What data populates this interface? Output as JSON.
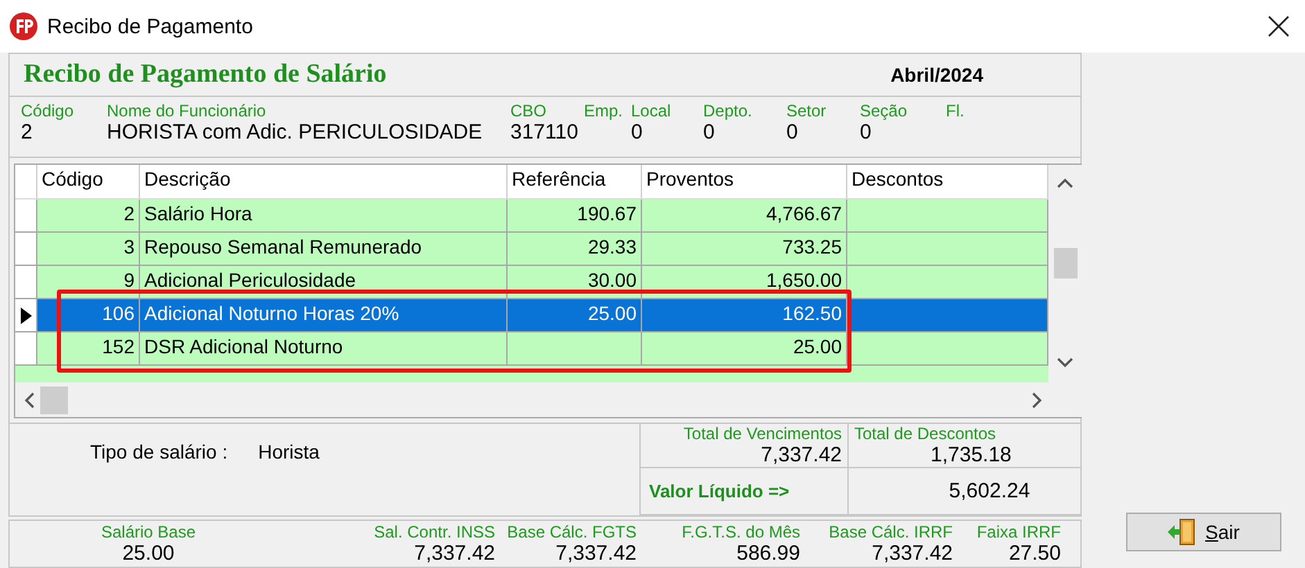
{
  "window": {
    "title": "Recibo de Pagamento"
  },
  "header": {
    "title": "Recibo de Pagamento de Salário",
    "period": "Abril/2024"
  },
  "employee_fields": [
    {
      "label": "Código",
      "value": "2"
    },
    {
      "label": "Nome do Funcionário",
      "value": "HORISTA com Adic. PERICULOSIDADE"
    },
    {
      "label": "CBO",
      "value": "317110"
    },
    {
      "label": "Emp."
    },
    {
      "label": "Local",
      "value": "0"
    },
    {
      "label": "Depto.",
      "value": "0"
    },
    {
      "label": "Setor",
      "value": "0"
    },
    {
      "label": "Seção",
      "value": "0"
    },
    {
      "label": "Fl."
    }
  ],
  "table": {
    "columns": [
      "Código",
      "Descrição",
      "Referência",
      "Proventos",
      "Descontos"
    ],
    "rows": [
      {
        "cells": [
          "2",
          "Salário Hora",
          "190.67",
          "4,766.67"
        ],
        "selected": false
      },
      {
        "cells": [
          "3",
          "Repouso Semanal Remunerado",
          "29.33",
          "733.25"
        ],
        "selected": false
      },
      {
        "cells": [
          "9",
          "Adicional Periculosidade",
          "30.00",
          "1,650.00"
        ],
        "selected": false
      },
      {
        "cells": [
          "106",
          "Adicional Noturno Horas 20%",
          "25.00",
          "162.50"
        ],
        "selected": true
      },
      {
        "cells": [
          "152",
          "DSR Adicional Noturno",
          "",
          "25.00"
        ],
        "selected": false
      }
    ]
  },
  "salary_type": {
    "label": "Tipo de salário :",
    "value": "Horista"
  },
  "totals": [
    {
      "label": "Total de Vencimentos",
      "value": "7,337.42"
    },
    {
      "label": "Total de Descontos",
      "value": "1,735.18"
    }
  ],
  "net": {
    "label": "Valor Líquido  =>",
    "value": "5,602.24"
  },
  "bases": [
    {
      "label": "Salário Base",
      "value": "25.00"
    },
    {
      "label": "Sal. Contr. INSS",
      "value": "7,337.42"
    },
    {
      "label": "Base Cálc. FGTS",
      "value": "7,337.42"
    },
    {
      "label": "F.G.T.S. do Mês",
      "value": "586.99"
    },
    {
      "label": "Base Cálc. IRRF",
      "value": "7,337.42"
    },
    {
      "label": "Faixa IRRF",
      "value": "27.50"
    }
  ],
  "buttons": [
    {
      "label": "Sair"
    }
  ]
}
